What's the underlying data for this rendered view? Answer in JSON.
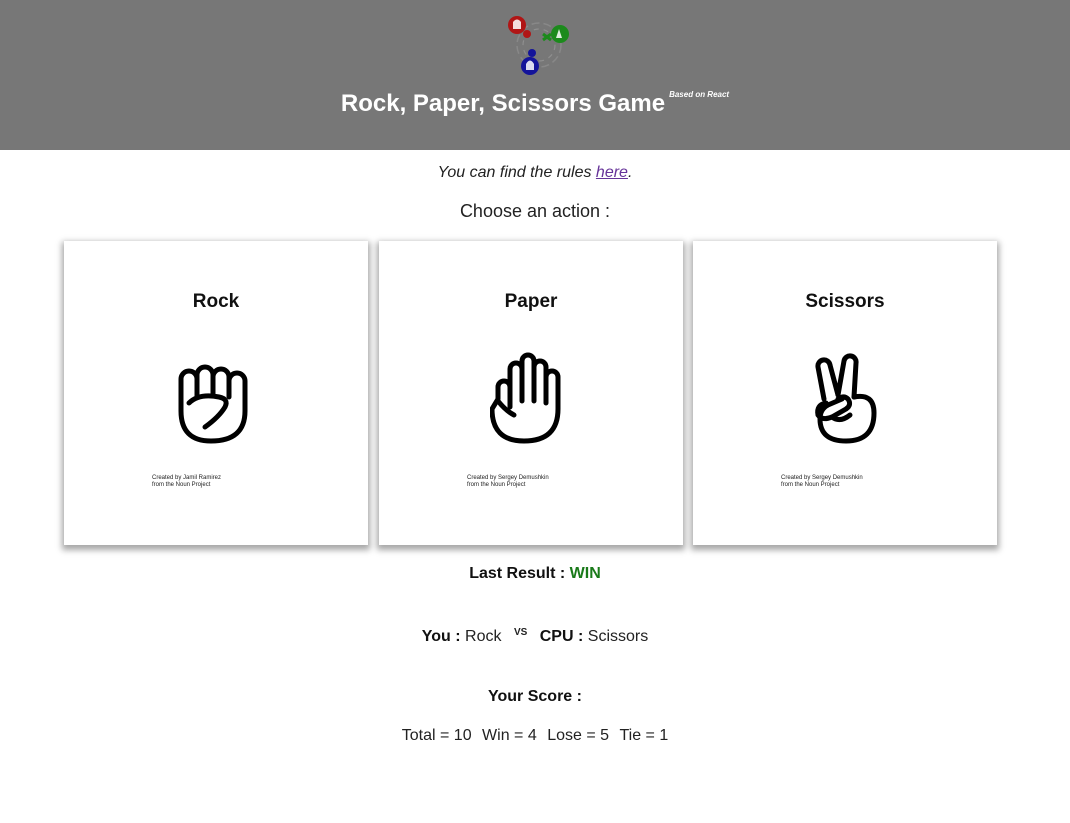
{
  "header": {
    "title": "Rock, Paper, Scissors Game",
    "subtitle": "Based on React",
    "background": "#777777"
  },
  "rules": {
    "prefix": "You can find the rules ",
    "link_text": "here",
    "suffix": "."
  },
  "choose_label": "Choose an action :",
  "cards": [
    {
      "title": "Rock",
      "icon": "rock-fist-icon",
      "credit_line1": "Created by Jamil Ramirez",
      "credit_line2": "from the Noun Project"
    },
    {
      "title": "Paper",
      "icon": "paper-hand-icon",
      "credit_line1": "Created by Sergey Demushkin",
      "credit_line2": "from the Noun Project"
    },
    {
      "title": "Scissors",
      "icon": "scissors-hand-icon",
      "credit_line1": "Created by Sergey Demushkin",
      "credit_line2": "from the Noun Project"
    }
  ],
  "last_result": {
    "label": "Last Result :",
    "value": "WIN",
    "color": "#1a7a1a"
  },
  "versus": {
    "you_label": "You :",
    "you_value": "Rock",
    "vs": "VS",
    "cpu_label": "CPU :",
    "cpu_value": "Scissors"
  },
  "score": {
    "title": "Your Score :",
    "total": "Total = 10",
    "win": "Win = 4",
    "lose": "Lose = 5",
    "tie": "Tie = 1"
  }
}
